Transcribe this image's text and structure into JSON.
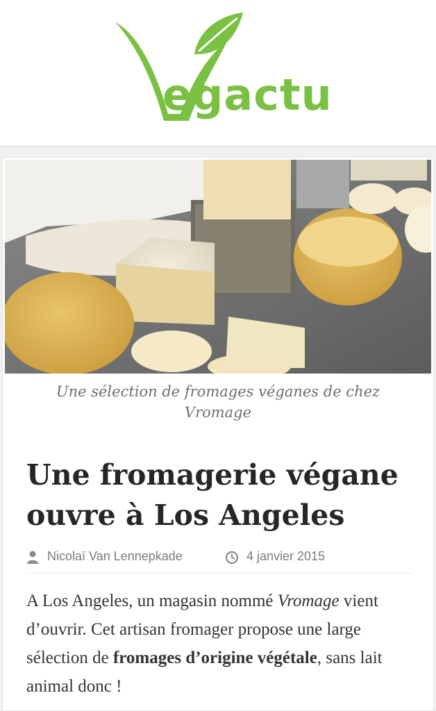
{
  "brand": {
    "logo_text": "egactu",
    "logo_initial": "V",
    "color": "#7ac143"
  },
  "article": {
    "image_alt": "Fromages véganes",
    "caption": "Une sélection de fromages véganes de chez Vromage",
    "title": "Une fromagerie végane ouvre à Los Angeles",
    "author": "Nicolaï Van Lennepkade",
    "date": "4 janvier 2015",
    "body": {
      "part1": "A Los Angeles, un magasin nommé ",
      "em": "Vromage",
      "part2": " vient d’ouvrir. Cet artisan fromager propose une large sélection de ",
      "strong": "fromages d’origine végétale",
      "part3": ", sans lait animal donc !"
    }
  },
  "icons": {
    "author": "user-icon",
    "date": "clock-icon"
  }
}
